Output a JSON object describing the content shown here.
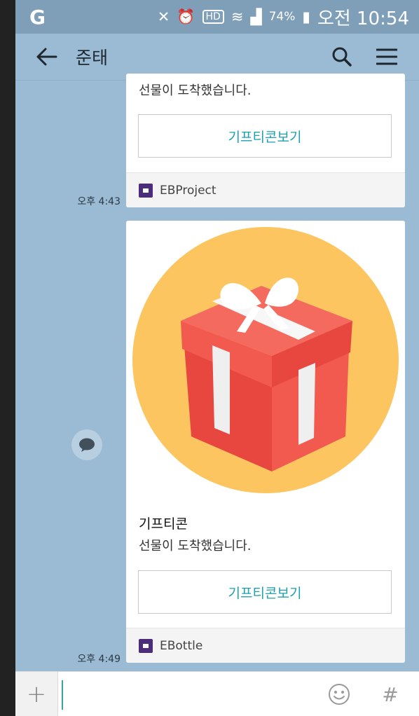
{
  "status_bar": {
    "battery_percent": "74%",
    "time": "오전 10:54"
  },
  "header": {
    "title": "준태"
  },
  "messages": [
    {
      "body": "선물이 도착했습니다.",
      "button_label": "기프티콘보기",
      "app_name": "EBProject",
      "timestamp": "오후 4:43"
    },
    {
      "title": "기프티콘",
      "body": "선물이 도착했습니다.",
      "button_label": "기프티콘보기",
      "app_name": "EBottle",
      "timestamp": "오후 4:49"
    }
  ],
  "input": {
    "plus_label": "+",
    "hash_label": "#"
  },
  "colors": {
    "chat_background": "#9bbbd4",
    "accent": "#1ea0b0",
    "gift_circle": "#fcc55f",
    "gift_box": "#f25a4f"
  },
  "icons": [
    "back-arrow-icon",
    "search-icon",
    "menu-icon",
    "gift-icon",
    "chat-bubble-icon",
    "emoji-icon"
  ]
}
